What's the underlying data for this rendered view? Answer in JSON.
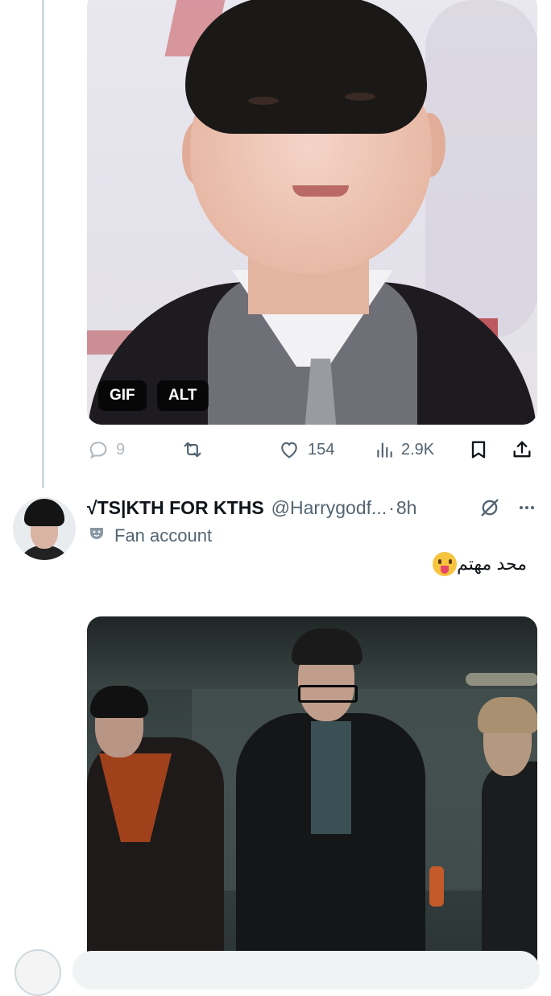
{
  "top_media": {
    "badges": {
      "gif": "GIF",
      "alt": "ALT"
    }
  },
  "top_actions": {
    "reply_count": "9",
    "like_count": "154",
    "views_count": "2.9K"
  },
  "tweet": {
    "display_name": "√TS|KTH FOR KTHS",
    "handle": "@Harrygodf...",
    "separator": "·",
    "time": "8h",
    "label": "Fan account",
    "text": "محد مهتم",
    "emoji": "face-with-tongue"
  },
  "colors": {
    "muted": "#536471",
    "text": "#0f1419",
    "thread_line": "#cfd9de"
  }
}
